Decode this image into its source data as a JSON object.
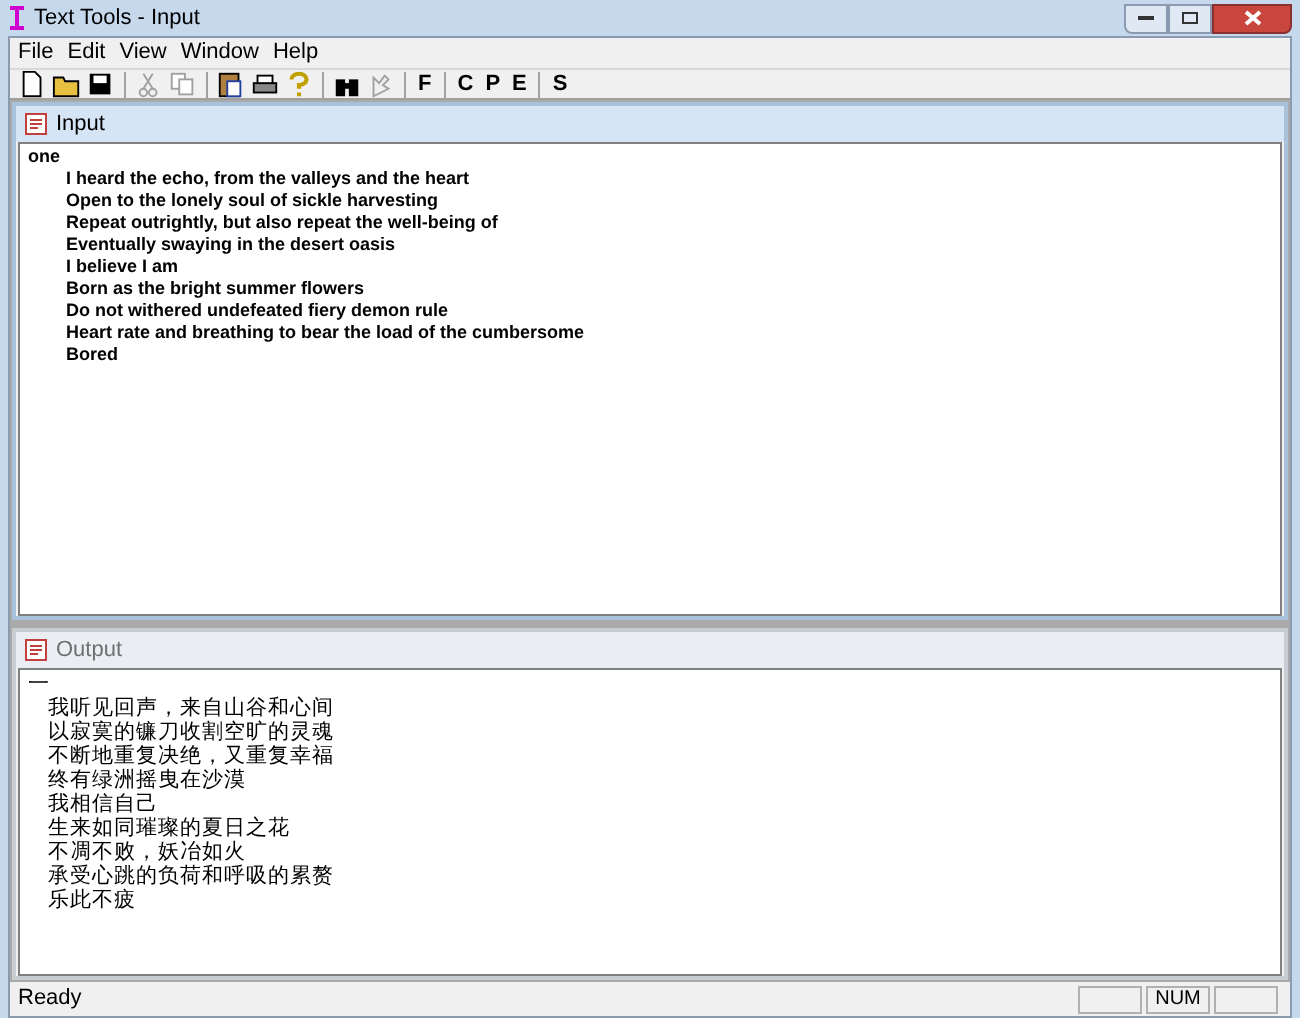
{
  "window": {
    "title": "Text Tools - Input"
  },
  "menu": [
    "File",
    "Edit",
    "View",
    "Window",
    "Help"
  ],
  "toolbar": [
    {
      "kind": "icon",
      "disabled": false
    },
    {
      "kind": "icon",
      "disabled": false
    },
    {
      "kind": "icon",
      "disabled": false
    },
    {
      "kind": "separator"
    },
    {
      "kind": "icon",
      "disabled": true
    },
    {
      "kind": "icon",
      "disabled": true
    },
    {
      "kind": "separator"
    },
    {
      "kind": "icon",
      "disabled": false
    },
    {
      "kind": "icon",
      "disabled": false
    },
    {
      "kind": "icon",
      "disabled": false
    },
    {
      "kind": "separator"
    },
    {
      "kind": "icon",
      "disabled": false
    },
    {
      "kind": "icon",
      "disabled": true
    },
    {
      "kind": "separator"
    },
    {
      "kind": "text",
      "label": "F"
    },
    {
      "kind": "separator"
    },
    {
      "kind": "text",
      "label": "C"
    },
    {
      "kind": "text",
      "label": "P"
    },
    {
      "kind": "text",
      "label": "E"
    },
    {
      "kind": "separator"
    },
    {
      "kind": "text",
      "label": "S"
    }
  ],
  "input": {
    "title": "Input",
    "active": true,
    "heading": "one",
    "lines": [
      "I heard the echo, from the valleys and the heart",
      "Open to the lonely soul of sickle harvesting",
      "Repeat outrightly, but also repeat the well-being of",
      "Eventually swaying in the desert oasis",
      "I believe I am",
      "Born as the bright summer flowers",
      "Do not withered undefeated fiery demon rule",
      "Heart rate and breathing to bear the load of the cumbersome",
      "Bored"
    ]
  },
  "output": {
    "title": "Output",
    "active": false,
    "heading": "一",
    "lines": [
      "我听见回声，来自山谷和心间",
      "以寂寞的镰刀收割空旷的灵魂",
      "不断地重复决绝，又重复幸福",
      "终有绿洲摇曳在沙漠",
      "我相信自己",
      "生来如同璀璨的夏日之花",
      "不凋不败，妖冶如火",
      "承受心跳的负荷和呼吸的累赘",
      "乐此不疲"
    ]
  },
  "status_bar": {
    "text": "Ready",
    "indicator": "NUM"
  }
}
